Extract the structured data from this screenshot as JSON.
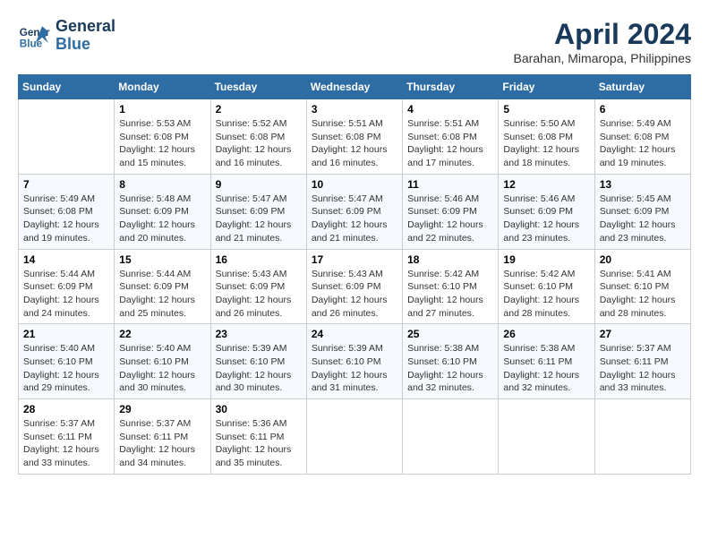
{
  "header": {
    "logo_line1": "General",
    "logo_line2": "Blue",
    "month_title": "April 2024",
    "subtitle": "Barahan, Mimaropa, Philippines"
  },
  "calendar": {
    "headers": [
      "Sunday",
      "Monday",
      "Tuesday",
      "Wednesday",
      "Thursday",
      "Friday",
      "Saturday"
    ],
    "weeks": [
      [
        {
          "day": "",
          "info": ""
        },
        {
          "day": "1",
          "info": "Sunrise: 5:53 AM\nSunset: 6:08 PM\nDaylight: 12 hours\nand 15 minutes."
        },
        {
          "day": "2",
          "info": "Sunrise: 5:52 AM\nSunset: 6:08 PM\nDaylight: 12 hours\nand 16 minutes."
        },
        {
          "day": "3",
          "info": "Sunrise: 5:51 AM\nSunset: 6:08 PM\nDaylight: 12 hours\nand 16 minutes."
        },
        {
          "day": "4",
          "info": "Sunrise: 5:51 AM\nSunset: 6:08 PM\nDaylight: 12 hours\nand 17 minutes."
        },
        {
          "day": "5",
          "info": "Sunrise: 5:50 AM\nSunset: 6:08 PM\nDaylight: 12 hours\nand 18 minutes."
        },
        {
          "day": "6",
          "info": "Sunrise: 5:49 AM\nSunset: 6:08 PM\nDaylight: 12 hours\nand 19 minutes."
        }
      ],
      [
        {
          "day": "7",
          "info": "Sunrise: 5:49 AM\nSunset: 6:08 PM\nDaylight: 12 hours\nand 19 minutes."
        },
        {
          "day": "8",
          "info": "Sunrise: 5:48 AM\nSunset: 6:09 PM\nDaylight: 12 hours\nand 20 minutes."
        },
        {
          "day": "9",
          "info": "Sunrise: 5:47 AM\nSunset: 6:09 PM\nDaylight: 12 hours\nand 21 minutes."
        },
        {
          "day": "10",
          "info": "Sunrise: 5:47 AM\nSunset: 6:09 PM\nDaylight: 12 hours\nand 21 minutes."
        },
        {
          "day": "11",
          "info": "Sunrise: 5:46 AM\nSunset: 6:09 PM\nDaylight: 12 hours\nand 22 minutes."
        },
        {
          "day": "12",
          "info": "Sunrise: 5:46 AM\nSunset: 6:09 PM\nDaylight: 12 hours\nand 23 minutes."
        },
        {
          "day": "13",
          "info": "Sunrise: 5:45 AM\nSunset: 6:09 PM\nDaylight: 12 hours\nand 23 minutes."
        }
      ],
      [
        {
          "day": "14",
          "info": "Sunrise: 5:44 AM\nSunset: 6:09 PM\nDaylight: 12 hours\nand 24 minutes."
        },
        {
          "day": "15",
          "info": "Sunrise: 5:44 AM\nSunset: 6:09 PM\nDaylight: 12 hours\nand 25 minutes."
        },
        {
          "day": "16",
          "info": "Sunrise: 5:43 AM\nSunset: 6:09 PM\nDaylight: 12 hours\nand 26 minutes."
        },
        {
          "day": "17",
          "info": "Sunrise: 5:43 AM\nSunset: 6:09 PM\nDaylight: 12 hours\nand 26 minutes."
        },
        {
          "day": "18",
          "info": "Sunrise: 5:42 AM\nSunset: 6:10 PM\nDaylight: 12 hours\nand 27 minutes."
        },
        {
          "day": "19",
          "info": "Sunrise: 5:42 AM\nSunset: 6:10 PM\nDaylight: 12 hours\nand 28 minutes."
        },
        {
          "day": "20",
          "info": "Sunrise: 5:41 AM\nSunset: 6:10 PM\nDaylight: 12 hours\nand 28 minutes."
        }
      ],
      [
        {
          "day": "21",
          "info": "Sunrise: 5:40 AM\nSunset: 6:10 PM\nDaylight: 12 hours\nand 29 minutes."
        },
        {
          "day": "22",
          "info": "Sunrise: 5:40 AM\nSunset: 6:10 PM\nDaylight: 12 hours\nand 30 minutes."
        },
        {
          "day": "23",
          "info": "Sunrise: 5:39 AM\nSunset: 6:10 PM\nDaylight: 12 hours\nand 30 minutes."
        },
        {
          "day": "24",
          "info": "Sunrise: 5:39 AM\nSunset: 6:10 PM\nDaylight: 12 hours\nand 31 minutes."
        },
        {
          "day": "25",
          "info": "Sunrise: 5:38 AM\nSunset: 6:10 PM\nDaylight: 12 hours\nand 32 minutes."
        },
        {
          "day": "26",
          "info": "Sunrise: 5:38 AM\nSunset: 6:11 PM\nDaylight: 12 hours\nand 32 minutes."
        },
        {
          "day": "27",
          "info": "Sunrise: 5:37 AM\nSunset: 6:11 PM\nDaylight: 12 hours\nand 33 minutes."
        }
      ],
      [
        {
          "day": "28",
          "info": "Sunrise: 5:37 AM\nSunset: 6:11 PM\nDaylight: 12 hours\nand 33 minutes."
        },
        {
          "day": "29",
          "info": "Sunrise: 5:37 AM\nSunset: 6:11 PM\nDaylight: 12 hours\nand 34 minutes."
        },
        {
          "day": "30",
          "info": "Sunrise: 5:36 AM\nSunset: 6:11 PM\nDaylight: 12 hours\nand 35 minutes."
        },
        {
          "day": "",
          "info": ""
        },
        {
          "day": "",
          "info": ""
        },
        {
          "day": "",
          "info": ""
        },
        {
          "day": "",
          "info": ""
        }
      ]
    ]
  }
}
